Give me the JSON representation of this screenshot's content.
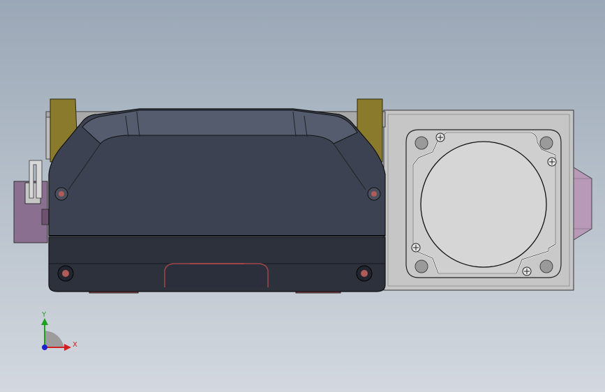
{
  "scene": {
    "view": "top",
    "model_parts": [
      "gripper-housing",
      "left-pad",
      "right-pad",
      "motor-flange-plate",
      "motor-body",
      "connector-tab",
      "side-bracket"
    ],
    "colors": {
      "background_top": "#9aa7b6",
      "background_bottom": "#d3d8df",
      "housing": "#3c4252",
      "housing_shadow": "#2b2f3b",
      "pad": "#8a7a2c",
      "flange_plate": "#c6c6c6",
      "motor_disc": "#d6d6d6",
      "connector": "#8a6f90",
      "accent_red": "#a04648"
    }
  },
  "triad": {
    "x_label": "X",
    "y_label": "Y",
    "x_color": "#d02020",
    "y_color": "#20a020",
    "z_color": "#2020d0"
  }
}
